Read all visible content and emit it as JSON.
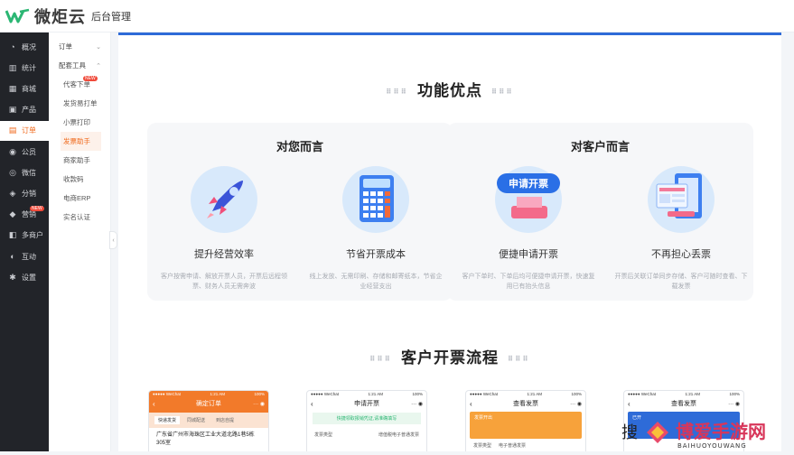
{
  "header": {
    "brand": "微炬云",
    "subtitle": "后台管理"
  },
  "sidebar": {
    "items": [
      {
        "label": "概况",
        "icon": "dashboard-icon",
        "glyph": "◔"
      },
      {
        "label": "统计",
        "icon": "stats-icon",
        "glyph": "▥"
      },
      {
        "label": "商城",
        "icon": "shop-icon",
        "glyph": "▦"
      },
      {
        "label": "产品",
        "icon": "product-icon",
        "glyph": "▣"
      },
      {
        "label": "订单",
        "icon": "order-icon",
        "glyph": "▤"
      },
      {
        "label": "公员",
        "icon": "member-icon",
        "glyph": "◉"
      },
      {
        "label": "微信",
        "icon": "wechat-icon",
        "glyph": "◎"
      },
      {
        "label": "分销",
        "icon": "distribution-icon",
        "glyph": "◈"
      },
      {
        "label": "营销",
        "icon": "marketing-icon",
        "glyph": "◆",
        "badge": "NEW"
      },
      {
        "label": "多商户",
        "icon": "merchant-icon",
        "glyph": "◧"
      },
      {
        "label": "互动",
        "icon": "interact-icon",
        "glyph": "◐"
      },
      {
        "label": "设置",
        "icon": "settings-icon",
        "glyph": "✱"
      }
    ]
  },
  "submenu": {
    "group1": "订单",
    "group2": "配套工具",
    "links": [
      {
        "label": "代客下单",
        "badge": "NEW"
      },
      {
        "label": "发货易打单"
      },
      {
        "label": "小票打印"
      },
      {
        "label": "发票助手"
      },
      {
        "label": "商家助手"
      },
      {
        "label": "收款码"
      },
      {
        "label": "电商ERP"
      },
      {
        "label": "实名认证"
      }
    ]
  },
  "main": {
    "section1_title": "功能优点",
    "card_left": {
      "title": "对您而言",
      "features": [
        {
          "name": "提升经营效率",
          "desc": "客户按需申请、解放开票人员，开票后远程领票、财务人员无需奔波"
        },
        {
          "name": "节省开票成本",
          "desc": "线上发放、无需印刷、存储和邮寄纸本，节省企业经营支出"
        }
      ]
    },
    "card_right": {
      "title": "对客户而言",
      "features": [
        {
          "name": "便捷申请开票",
          "desc": "客户下单时、下单后均可便捷申请开票，快速复用已有抬头信息",
          "badge_text": "申请开票"
        },
        {
          "name": "不再担心丢票",
          "desc": "开票后关联订单同步存储、客户可随时查看、下载发票"
        }
      ]
    },
    "section2_title": "客户开票流程",
    "phones": [
      {
        "title": "确定订单",
        "color": "#f27a2a",
        "address": "广东省广州市海珠区工业大道北路1巷5栋305室",
        "tabs": [
          "快递发货",
          "同城配送",
          "到店自提"
        ]
      },
      {
        "title": "申请开票",
        "color": "#ffffff",
        "banner": "快捷领取报销凭证,请准确填写",
        "row_label": "发票类型",
        "row_value": "增值税电子普通发票"
      },
      {
        "title": "查看发票",
        "color": "#f27a2a",
        "status": "发票开出",
        "row_label": "发票类型",
        "row_value": "电子普通发票"
      },
      {
        "title": "查看发票",
        "color": "#ffffff",
        "status": "已开"
      }
    ]
  },
  "watermark": {
    "text": "博爱手游网",
    "sub": "BAIHUOYOUWANG",
    "prefix": "搜"
  }
}
